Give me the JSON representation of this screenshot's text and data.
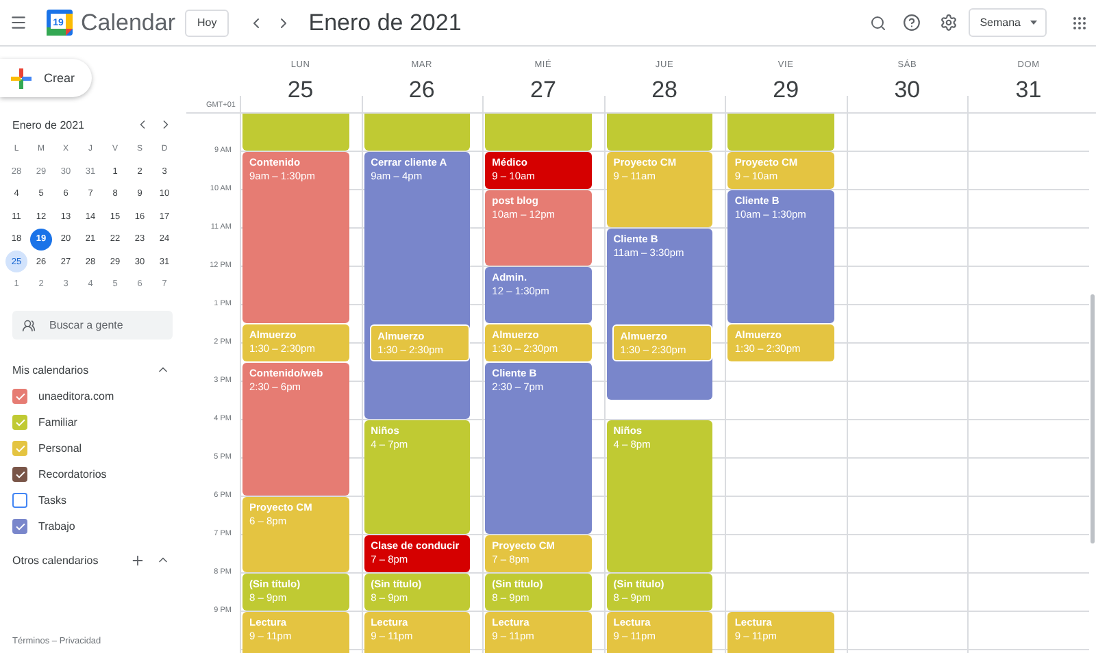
{
  "app": {
    "name": "Calendar",
    "logo_day": "19"
  },
  "toolbar": {
    "today_button": "Hoy",
    "period": "Enero de 2021",
    "view": "Semana"
  },
  "create_button": "Crear",
  "mini_calendar": {
    "title": "Enero de 2021",
    "weekdays": [
      "L",
      "M",
      "X",
      "J",
      "V",
      "S",
      "D"
    ],
    "weeks": [
      [
        {
          "day": "28",
          "other_month": true,
          "today": false,
          "selected": false
        },
        {
          "day": "29",
          "other_month": true,
          "today": false,
          "selected": false
        },
        {
          "day": "30",
          "other_month": true,
          "today": false,
          "selected": false
        },
        {
          "day": "31",
          "other_month": true,
          "today": false,
          "selected": false
        },
        {
          "day": "1",
          "other_month": false,
          "today": false,
          "selected": false
        },
        {
          "day": "2",
          "other_month": false,
          "today": false,
          "selected": false
        },
        {
          "day": "3",
          "other_month": false,
          "today": false,
          "selected": false
        }
      ],
      [
        {
          "day": "4",
          "other_month": false,
          "today": false,
          "selected": false
        },
        {
          "day": "5",
          "other_month": false,
          "today": false,
          "selected": false
        },
        {
          "day": "6",
          "other_month": false,
          "today": false,
          "selected": false
        },
        {
          "day": "7",
          "other_month": false,
          "today": false,
          "selected": false
        },
        {
          "day": "8",
          "other_month": false,
          "today": false,
          "selected": false
        },
        {
          "day": "9",
          "other_month": false,
          "today": false,
          "selected": false
        },
        {
          "day": "10",
          "other_month": false,
          "today": false,
          "selected": false
        }
      ],
      [
        {
          "day": "11",
          "other_month": false,
          "today": false,
          "selected": false
        },
        {
          "day": "12",
          "other_month": false,
          "today": false,
          "selected": false
        },
        {
          "day": "13",
          "other_month": false,
          "today": false,
          "selected": false
        },
        {
          "day": "14",
          "other_month": false,
          "today": false,
          "selected": false
        },
        {
          "day": "15",
          "other_month": false,
          "today": false,
          "selected": false
        },
        {
          "day": "16",
          "other_month": false,
          "today": false,
          "selected": false
        },
        {
          "day": "17",
          "other_month": false,
          "today": false,
          "selected": false
        }
      ],
      [
        {
          "day": "18",
          "other_month": false,
          "today": false,
          "selected": false
        },
        {
          "day": "19",
          "other_month": false,
          "today": true,
          "selected": false
        },
        {
          "day": "20",
          "other_month": false,
          "today": false,
          "selected": false
        },
        {
          "day": "21",
          "other_month": false,
          "today": false,
          "selected": false
        },
        {
          "day": "22",
          "other_month": false,
          "today": false,
          "selected": false
        },
        {
          "day": "23",
          "other_month": false,
          "today": false,
          "selected": false
        },
        {
          "day": "24",
          "other_month": false,
          "today": false,
          "selected": false
        }
      ],
      [
        {
          "day": "25",
          "other_month": false,
          "today": false,
          "selected": true
        },
        {
          "day": "26",
          "other_month": false,
          "today": false,
          "selected": false
        },
        {
          "day": "27",
          "other_month": false,
          "today": false,
          "selected": false
        },
        {
          "day": "28",
          "other_month": false,
          "today": false,
          "selected": false
        },
        {
          "day": "29",
          "other_month": false,
          "today": false,
          "selected": false
        },
        {
          "day": "30",
          "other_month": false,
          "today": false,
          "selected": false
        },
        {
          "day": "31",
          "other_month": false,
          "today": false,
          "selected": false
        }
      ],
      [
        {
          "day": "1",
          "other_month": true,
          "today": false,
          "selected": false
        },
        {
          "day": "2",
          "other_month": true,
          "today": false,
          "selected": false
        },
        {
          "day": "3",
          "other_month": true,
          "today": false,
          "selected": false
        },
        {
          "day": "4",
          "other_month": true,
          "today": false,
          "selected": false
        },
        {
          "day": "5",
          "other_month": true,
          "today": false,
          "selected": false
        },
        {
          "day": "6",
          "other_month": true,
          "today": false,
          "selected": false
        },
        {
          "day": "7",
          "other_month": true,
          "today": false,
          "selected": false
        }
      ]
    ]
  },
  "people_search": {
    "placeholder": "Buscar a gente"
  },
  "my_calendars": {
    "title": "Mis calendarios",
    "expanded": true,
    "items": [
      {
        "name": "unaeditora.com",
        "checked": true,
        "color": "#e67c73"
      },
      {
        "name": "Familiar",
        "checked": true,
        "color": "#c0ca33"
      },
      {
        "name": "Personal",
        "checked": true,
        "color": "#e4c441"
      },
      {
        "name": "Recordatorios",
        "checked": true,
        "color": "#795548"
      },
      {
        "name": "Tasks",
        "checked": false,
        "color": "#4285f4"
      },
      {
        "name": "Trabajo",
        "checked": true,
        "color": "#7986cb"
      }
    ]
  },
  "other_calendars": {
    "title": "Otros calendarios",
    "expanded": true
  },
  "footer": "Términos – Privacidad",
  "timezone": "GMT+01",
  "hours": [
    "9 AM",
    "10 AM",
    "11 AM",
    "12 PM",
    "1 PM",
    "2 PM",
    "3 PM",
    "4 PM",
    "5 PM",
    "6 PM",
    "7 PM",
    "8 PM",
    "9 PM"
  ],
  "days": [
    {
      "weekday": "LUN",
      "date": "25",
      "events": [
        {
          "kind": "continued",
          "color": "#c0ca33",
          "overlap": false
        },
        {
          "kind": "timed",
          "title": "Contenido",
          "time": "9am – 1:30pm",
          "color": "#e67c73",
          "overlap": false
        },
        {
          "kind": "timed",
          "title": "Almuerzo",
          "time": "1:30 – 2:30pm",
          "color": "#e4c441",
          "overlap": false
        },
        {
          "kind": "timed",
          "title": "Contenido/web",
          "time": "2:30 – 6pm",
          "color": "#e67c73",
          "overlap": false
        },
        {
          "kind": "timed",
          "title": "Proyecto CM",
          "time": "6 – 8pm",
          "color": "#e4c441",
          "overlap": false
        },
        {
          "kind": "timed",
          "title": "(Sin título)",
          "time": "8 – 9pm",
          "color": "#c0ca33",
          "overlap": false
        },
        {
          "kind": "timed",
          "title": "Lectura",
          "time": "9 – 11pm",
          "color": "#e4c441",
          "overlap": false
        }
      ]
    },
    {
      "weekday": "MAR",
      "date": "26",
      "events": [
        {
          "kind": "continued",
          "color": "#c0ca33",
          "overlap": false
        },
        {
          "kind": "timed",
          "title": "Cerrar cliente A",
          "time": "9am – 4pm",
          "color": "#7986cb",
          "overlap": false
        },
        {
          "kind": "timed",
          "title": "Almuerzo",
          "time": "1:30 – 2:30pm",
          "color": "#e4c441",
          "overlap": true
        },
        {
          "kind": "timed",
          "title": "Niños",
          "time": "4 – 7pm",
          "color": "#c0ca33",
          "overlap": false
        },
        {
          "kind": "timed",
          "title": "Clase de conducir",
          "time": "7 – 8pm",
          "color": "#d50000",
          "overlap": false
        },
        {
          "kind": "timed",
          "title": "(Sin título)",
          "time": "8 – 9pm",
          "color": "#c0ca33",
          "overlap": false
        },
        {
          "kind": "timed",
          "title": "Lectura",
          "time": "9 – 11pm",
          "color": "#e4c441",
          "overlap": false
        }
      ]
    },
    {
      "weekday": "MIÉ",
      "date": "27",
      "events": [
        {
          "kind": "continued",
          "color": "#c0ca33",
          "overlap": false
        },
        {
          "kind": "timed",
          "title": "Médico",
          "time": "9 – 10am",
          "color": "#d50000",
          "overlap": false
        },
        {
          "kind": "timed",
          "title": "post blog",
          "time": "10am – 12pm",
          "color": "#e67c73",
          "overlap": false
        },
        {
          "kind": "timed",
          "title": "Admin.",
          "time": "12 – 1:30pm",
          "color": "#7986cb",
          "overlap": false
        },
        {
          "kind": "timed",
          "title": "Almuerzo",
          "time": "1:30 – 2:30pm",
          "color": "#e4c441",
          "overlap": false
        },
        {
          "kind": "timed",
          "title": "Cliente B",
          "time": "2:30 – 7pm",
          "color": "#7986cb",
          "overlap": false
        },
        {
          "kind": "timed",
          "title": "Proyecto CM",
          "time": "7 – 8pm",
          "color": "#e4c441",
          "overlap": false
        },
        {
          "kind": "timed",
          "title": "(Sin título)",
          "time": "8 – 9pm",
          "color": "#c0ca33",
          "overlap": false
        },
        {
          "kind": "timed",
          "title": "Lectura",
          "time": "9 – 11pm",
          "color": "#e4c441",
          "overlap": false
        }
      ]
    },
    {
      "weekday": "JUE",
      "date": "28",
      "events": [
        {
          "kind": "continued",
          "color": "#c0ca33",
          "overlap": false
        },
        {
          "kind": "timed",
          "title": "Proyecto CM",
          "time": "9 – 11am",
          "color": "#e4c441",
          "overlap": false
        },
        {
          "kind": "timed",
          "title": "Cliente B",
          "time": "11am – 3:30pm",
          "color": "#7986cb",
          "overlap": false
        },
        {
          "kind": "timed",
          "title": "Almuerzo",
          "time": "1:30 – 2:30pm",
          "color": "#e4c441",
          "overlap": true
        },
        {
          "kind": "timed",
          "title": "Niños",
          "time": "4 – 8pm",
          "color": "#c0ca33",
          "overlap": false
        },
        {
          "kind": "timed",
          "title": "(Sin título)",
          "time": "8 – 9pm",
          "color": "#c0ca33",
          "overlap": false
        },
        {
          "kind": "timed",
          "title": "Lectura",
          "time": "9 – 11pm",
          "color": "#e4c441",
          "overlap": false
        }
      ]
    },
    {
      "weekday": "VIE",
      "date": "29",
      "events": [
        {
          "kind": "continued",
          "color": "#c0ca33",
          "overlap": false
        },
        {
          "kind": "timed",
          "title": "Proyecto CM",
          "time": "9 – 10am",
          "color": "#e4c441",
          "overlap": false
        },
        {
          "kind": "timed",
          "title": "Cliente B",
          "time": "10am – 1:30pm",
          "color": "#7986cb",
          "overlap": false
        },
        {
          "kind": "timed",
          "title": "Almuerzo",
          "time": "1:30 – 2:30pm",
          "color": "#e4c441",
          "overlap": false
        },
        {
          "kind": "timed",
          "title": "Lectura",
          "time": "9 – 11pm",
          "color": "#e4c441",
          "overlap": false
        }
      ]
    },
    {
      "weekday": "SÁB",
      "date": "30"
    },
    {
      "weekday": "DOM",
      "date": "31"
    }
  ]
}
